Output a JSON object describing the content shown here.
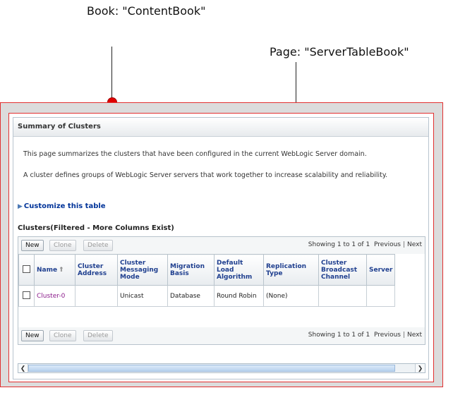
{
  "callouts": {
    "book": "Book: \"ContentBook\"",
    "page": "Page: \"ServerTableBook\""
  },
  "panel": {
    "title": "Summary of Clusters",
    "description_1": "This page summarizes the clusters that have been configured in the current WebLogic Server domain.",
    "description_2": "A cluster defines groups of WebLogic Server servers that work together to increase scalability and reliability.",
    "customize_link": "Customize this table",
    "table_title": "Clusters(Filtered - More Columns Exist)"
  },
  "toolbar": {
    "new_label": "New",
    "clone_label": "Clone",
    "delete_label": "Delete",
    "showing_text": "Showing 1 to 1 of 1",
    "previous_label": "Previous",
    "next_label": "Next"
  },
  "table": {
    "columns": [
      "Name",
      "Cluster Address",
      "Cluster Messaging Mode",
      "Migration Basis",
      "Default Load Algorithm",
      "Replication Type",
      "Cluster Broadcast Channel",
      "Server"
    ],
    "rows": [
      {
        "name": "Cluster-0",
        "cluster_address": "",
        "messaging_mode": "Unicast",
        "migration_basis": "Database",
        "load_algorithm": "Round Robin",
        "replication_type": "(None)",
        "broadcast_channel": "",
        "server": ""
      }
    ]
  },
  "colors": {
    "frame_red": "#e23030",
    "callout_dot": "#e00000",
    "header_text": "#1f3f8f",
    "link_text": "#8a1a8a"
  }
}
